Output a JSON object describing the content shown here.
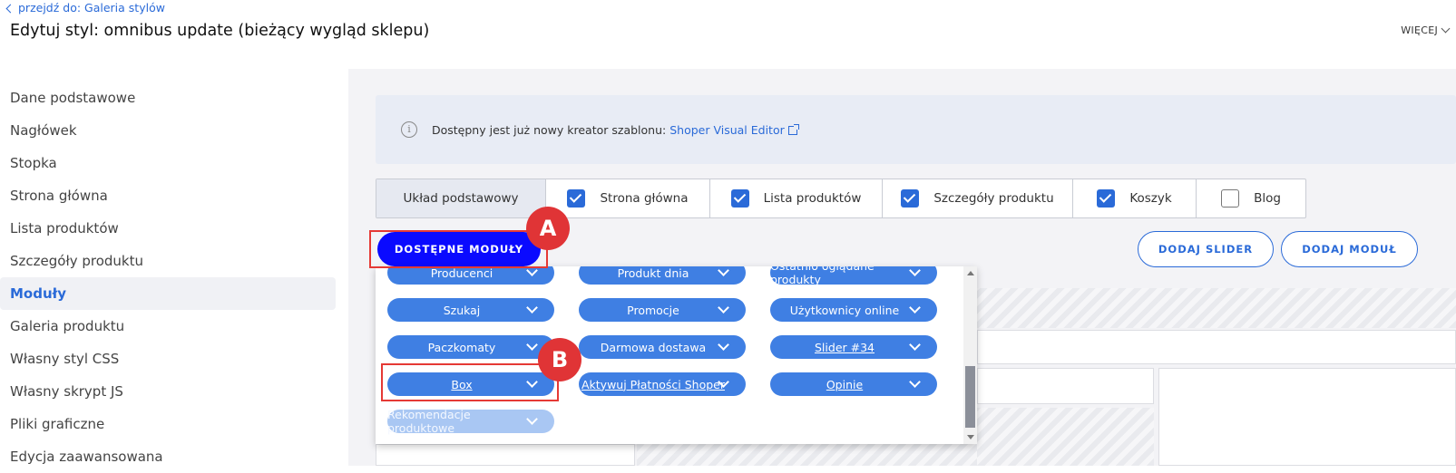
{
  "header": {
    "back_link": "przejdź do: Galeria stylów",
    "title": "Edytuj styl: omnibus update (bieżący wygląd sklepu)",
    "more_label": "WIĘCEJ"
  },
  "sidebar": {
    "items": [
      {
        "label": "Dane podstawowe"
      },
      {
        "label": "Nagłówek"
      },
      {
        "label": "Stopka"
      },
      {
        "label": "Strona główna"
      },
      {
        "label": "Lista produktów"
      },
      {
        "label": "Szczegóły produktu"
      },
      {
        "label": "Moduły"
      },
      {
        "label": "Galeria produktu"
      },
      {
        "label": "Własny styl CSS"
      },
      {
        "label": "Własny skrypt JS"
      },
      {
        "label": "Pliki graficzne"
      },
      {
        "label": "Edycja zaawansowana"
      }
    ],
    "active_index": 6
  },
  "info": {
    "text": "Dostępny jest już nowy kreator szablonu:",
    "link": "Shoper Visual Editor"
  },
  "tabs": [
    {
      "label": "Układ podstawowy",
      "checked": null
    },
    {
      "label": "Strona główna",
      "checked": true
    },
    {
      "label": "Lista produktów",
      "checked": true
    },
    {
      "label": "Szczegóły produktu",
      "checked": true
    },
    {
      "label": "Koszyk",
      "checked": true
    },
    {
      "label": "Blog",
      "checked": false
    }
  ],
  "buttons": {
    "available_modules": "DOSTĘPNE MODUŁY",
    "add_slider": "DODAJ SLIDER",
    "add_module": "DODAJ MODUŁ"
  },
  "annotations": {
    "a": "A",
    "b": "B"
  },
  "modules": [
    {
      "label": "Producenci",
      "linked": false
    },
    {
      "label": "Produkt dnia",
      "linked": false
    },
    {
      "label": "Ostatnio oglądane produkty",
      "linked": false
    },
    {
      "label": "Szukaj",
      "linked": false
    },
    {
      "label": "Promocje",
      "linked": false
    },
    {
      "label": "Użytkownicy online",
      "linked": false
    },
    {
      "label": "Paczkomaty",
      "linked": false
    },
    {
      "label": "Darmowa dostawa",
      "linked": false
    },
    {
      "label": "Slider #34",
      "linked": true
    },
    {
      "label": "Box",
      "linked": true
    },
    {
      "label": "Aktywuj Płatności Shoper",
      "linked": true
    },
    {
      "label": "Opinie",
      "linked": true
    },
    {
      "label": "Rekomendacje produktowe",
      "linked": false
    }
  ],
  "colors": {
    "accent": "#2a6ad8",
    "primary_button": "#0a0aff",
    "module_pill": "#3f7fe3",
    "highlight": "#e53935"
  }
}
